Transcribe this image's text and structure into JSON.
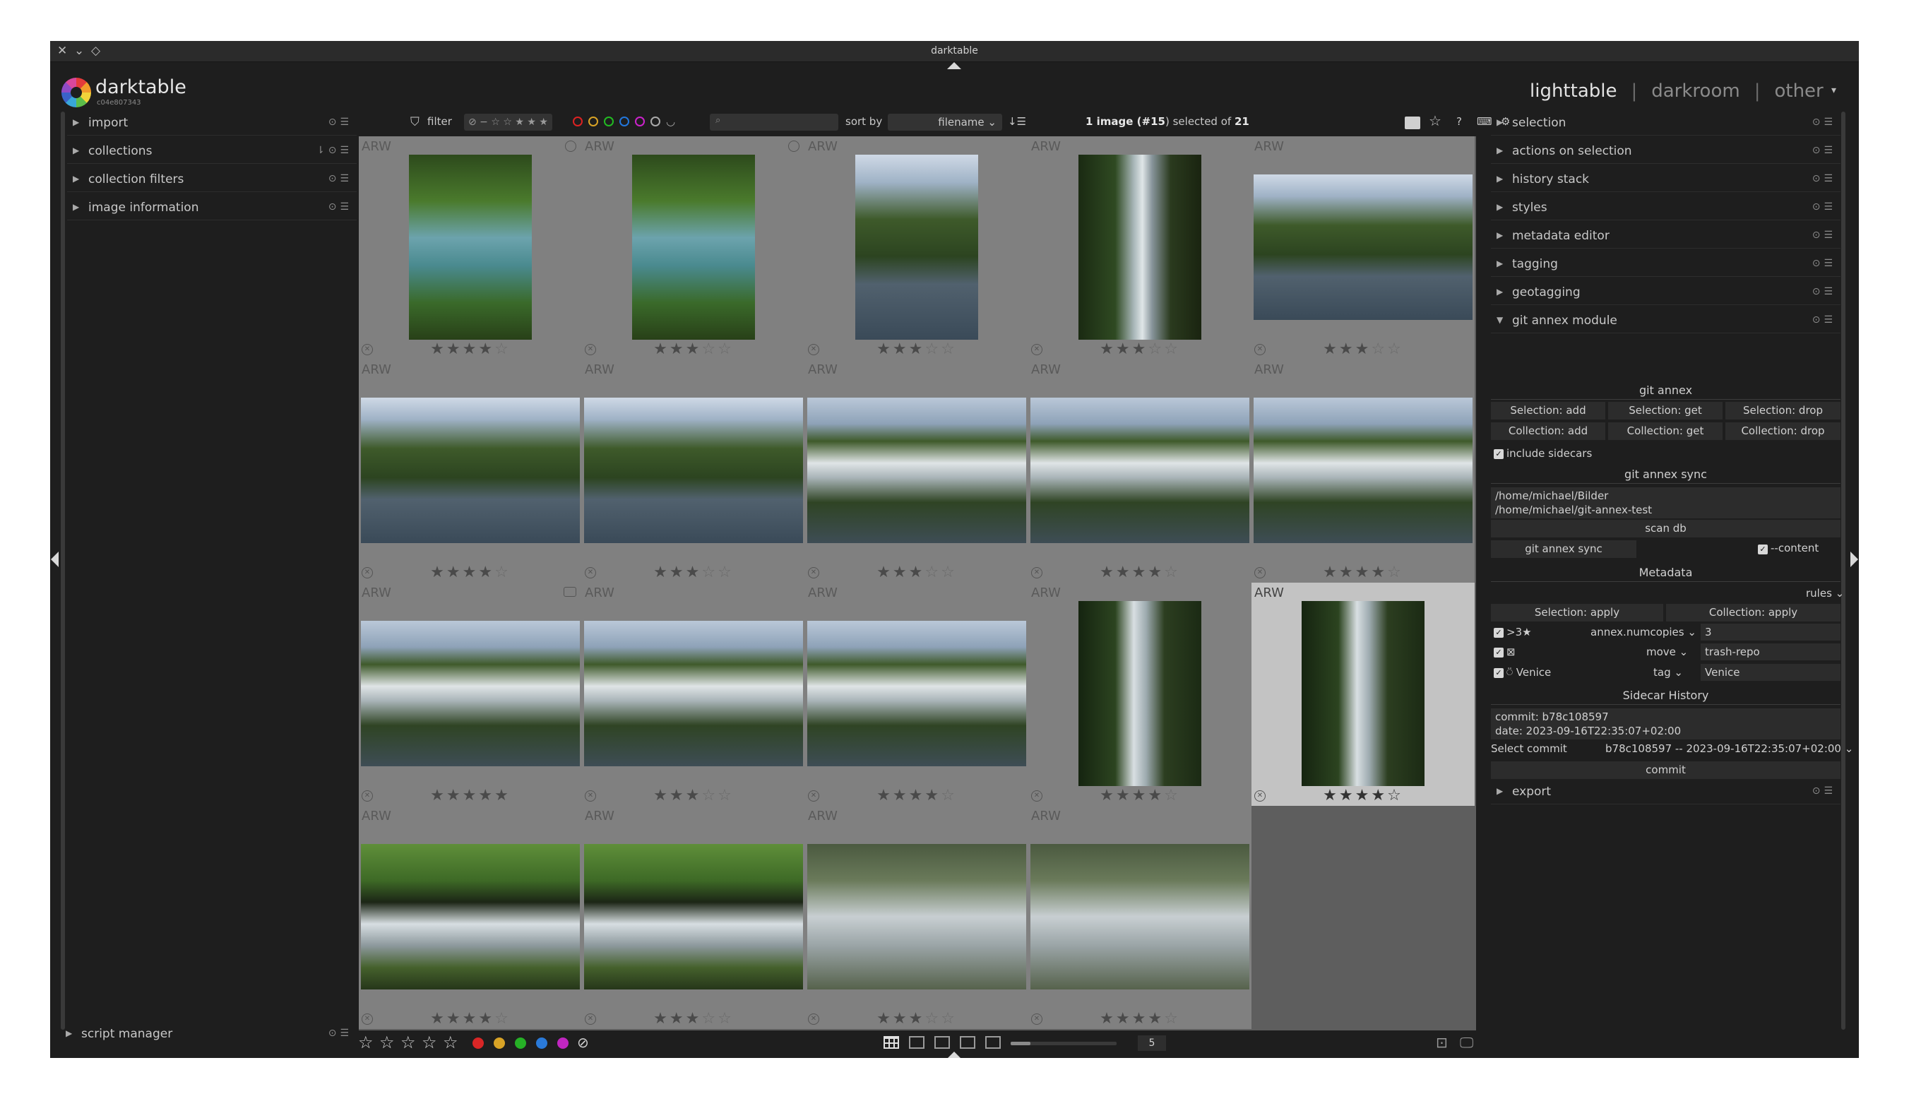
{
  "window": {
    "title": "darktable"
  },
  "header": {
    "app_name": "darktable",
    "app_version": "c04e807343",
    "views": [
      "lighttable",
      "darkroom",
      "other"
    ],
    "active_view": "lighttable"
  },
  "left_panel": {
    "modules": [
      "import",
      "collections",
      "collection filters",
      "image information"
    ],
    "bottom_module": "script manager"
  },
  "toolbar": {
    "filter_label": "filter",
    "rating_filter": "⊘ − ☆ ☆ ★ ★ ★",
    "search_placeholder": "",
    "sort_label": "sort by",
    "sort_value": "filename",
    "count_prefix": "1 image (",
    "count_index": "#15",
    "count_middle": ") selected of ",
    "count_total": "21"
  },
  "grid": {
    "format_label": "ARW",
    "thumbnails": [
      {
        "rating": 4,
        "orient": "portrait",
        "style": "forest"
      },
      {
        "rating": 3,
        "orient": "portrait",
        "style": "forest"
      },
      {
        "rating": 3,
        "orient": "portrait",
        "style": "river"
      },
      {
        "rating": 3,
        "orient": "portrait",
        "style": "falls-tall"
      },
      {
        "rating": 3,
        "orient": "landscape",
        "style": "river"
      },
      {
        "rating": 4,
        "orient": "landscape",
        "style": "river"
      },
      {
        "rating": 3,
        "orient": "landscape",
        "style": "river"
      },
      {
        "rating": 3,
        "orient": "landscape",
        "style": "falls-wide"
      },
      {
        "rating": 4,
        "orient": "landscape",
        "style": "falls-wide"
      },
      {
        "rating": 4,
        "orient": "landscape",
        "style": "falls-wide"
      },
      {
        "rating": 5,
        "orient": "landscape",
        "style": "falls-wide"
      },
      {
        "rating": 3,
        "orient": "landscape",
        "style": "falls-wide"
      },
      {
        "rating": 4,
        "orient": "landscape",
        "style": "falls-wide"
      },
      {
        "rating": 4,
        "orient": "portrait",
        "style": "falls-vert"
      },
      {
        "rating": 4,
        "orient": "portrait",
        "style": "falls-vert",
        "selected": true
      },
      {
        "rating": 4,
        "orient": "landscape",
        "style": "green-falls"
      },
      {
        "rating": 3,
        "orient": "landscape",
        "style": "green-falls"
      },
      {
        "rating": 3,
        "orient": "landscape",
        "style": "mist"
      },
      {
        "rating": 4,
        "orient": "landscape",
        "style": "mist"
      }
    ]
  },
  "right_panel": {
    "modules": [
      "selection",
      "actions on selection",
      "history stack",
      "styles",
      "metadata editor",
      "tagging",
      "geotagging",
      "git annex module"
    ],
    "bottom_module": "export",
    "git_annex": {
      "title": "git annex",
      "buttons_row1": [
        "Selection: add",
        "Selection: get",
        "Selection: drop"
      ],
      "buttons_row2": [
        "Collection: add",
        "Collection: get",
        "Collection: drop"
      ],
      "include_sidecars": "include sidecars",
      "sync_title": "git annex sync",
      "paths": [
        "/home/michael/Bilder",
        "/home/michael/git-annex-test"
      ],
      "scan_db": "scan db",
      "sync_button": "git annex sync",
      "content_label": "--content",
      "metadata_title": "Metadata",
      "rules_label": "rules",
      "meta_buttons": [
        "Selection: apply",
        "Collection: apply"
      ],
      "rules": [
        {
          "cond": ">3★",
          "action": "annex.numcopies",
          "value": "3"
        },
        {
          "cond": "⊠",
          "action": "move",
          "value": "trash-repo"
        },
        {
          "cond": "Venice",
          "action": "tag",
          "value": "Venice"
        }
      ],
      "sidecar_title": "Sidecar History",
      "commit_line": "commit: b78c108597",
      "date_line": "date: 2023-09-16T22:35:07+02:00",
      "select_commit_label": "Select commit",
      "select_commit_value": "b78c108597 -- 2023-09-16T22:35:07+02:00",
      "commit_button": "commit"
    }
  },
  "bottom_bar": {
    "zoom_value": "5",
    "color_labels": [
      "#d92626",
      "#d9a326",
      "#26b026",
      "#2a7ad9",
      "#c026c0"
    ]
  }
}
